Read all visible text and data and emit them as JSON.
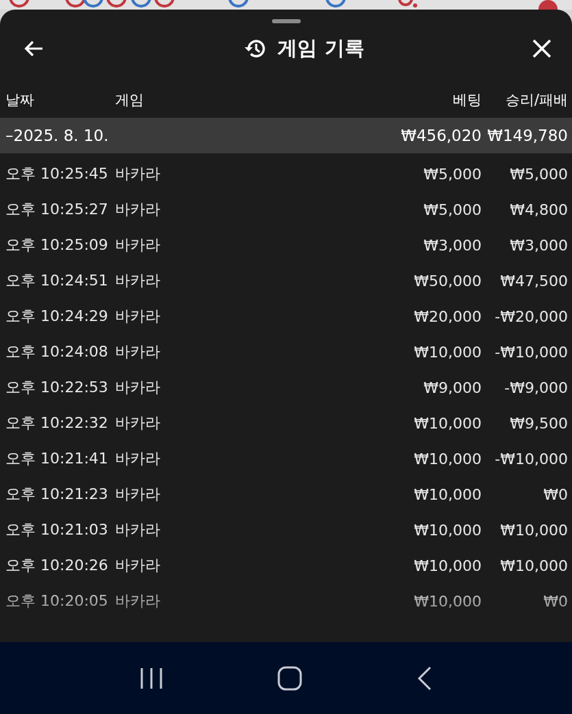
{
  "header": {
    "title": "게임 기록"
  },
  "columns": [
    "날짜",
    "게임",
    "베팅",
    "승리/패배"
  ],
  "date_group": {
    "date": "–2025. 8. 10.",
    "bet_total": "₩456,020",
    "result_total": "₩149,780"
  },
  "rows": [
    {
      "time": "오후 10:25:45",
      "game": "바카라",
      "bet": "₩5,000",
      "result": "₩5,000"
    },
    {
      "time": "오후 10:25:27",
      "game": "바카라",
      "bet": "₩5,000",
      "result": "₩4,800"
    },
    {
      "time": "오후 10:25:09",
      "game": "바카라",
      "bet": "₩3,000",
      "result": "₩3,000"
    },
    {
      "time": "오후 10:24:51",
      "game": "바카라",
      "bet": "₩50,000",
      "result": "₩47,500"
    },
    {
      "time": "오후 10:24:29",
      "game": "바카라",
      "bet": "₩20,000",
      "result": "-₩20,000"
    },
    {
      "time": "오후 10:24:08",
      "game": "바카라",
      "bet": "₩10,000",
      "result": "-₩10,000"
    },
    {
      "time": "오후 10:22:53",
      "game": "바카라",
      "bet": "₩9,000",
      "result": "-₩9,000"
    },
    {
      "time": "오후 10:22:32",
      "game": "바카라",
      "bet": "₩10,000",
      "result": "₩9,500"
    },
    {
      "time": "오후 10:21:41",
      "game": "바카라",
      "bet": "₩10,000",
      "result": "-₩10,000"
    },
    {
      "time": "오후 10:21:23",
      "game": "바카라",
      "bet": "₩10,000",
      "result": "₩0"
    },
    {
      "time": "오후 10:21:03",
      "game": "바카라",
      "bet": "₩10,000",
      "result": "₩10,000"
    },
    {
      "time": "오후 10:20:26",
      "game": "바카라",
      "bet": "₩10,000",
      "result": "₩10,000"
    },
    {
      "time": "오후 10:20:05",
      "game": "바카라",
      "bet": "₩10,000",
      "result": "₩0"
    }
  ]
}
